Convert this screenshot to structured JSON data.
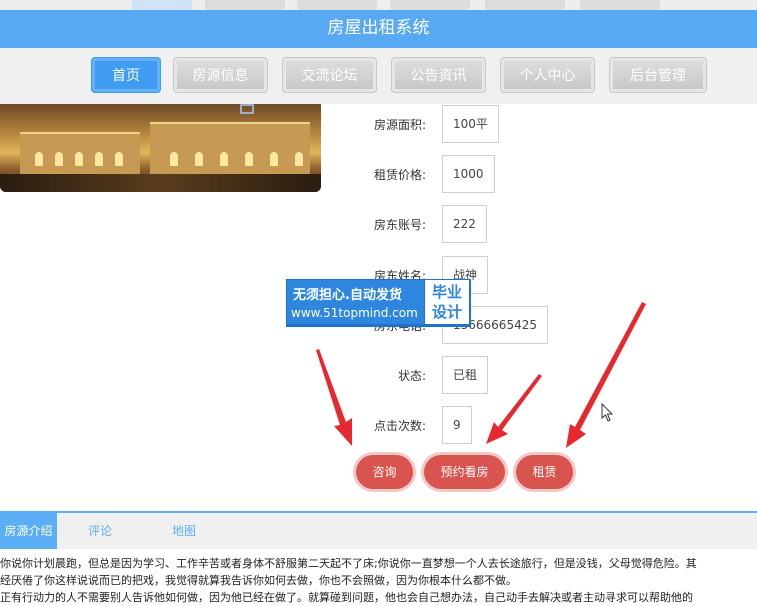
{
  "header": {
    "title": "房屋出租系统"
  },
  "nav": {
    "items": [
      {
        "label": "首页",
        "active": true
      },
      {
        "label": "房源信息",
        "active": false
      },
      {
        "label": "交流论坛",
        "active": false
      },
      {
        "label": "公告资讯",
        "active": false
      },
      {
        "label": "个人中心",
        "active": false
      },
      {
        "label": "后台管理",
        "active": false
      }
    ]
  },
  "details": {
    "fields": [
      {
        "label": "房源面积:",
        "value": "100平"
      },
      {
        "label": "租赁价格:",
        "value": "1000"
      },
      {
        "label": "房东账号:",
        "value": "222"
      },
      {
        "label": "房东姓名:",
        "value": "战神"
      },
      {
        "label": "房东电话:",
        "value": "13666665425"
      },
      {
        "label": "状态:",
        "value": "已租"
      },
      {
        "label": "点击次数:",
        "value": "9"
      }
    ]
  },
  "actions": {
    "consult": "咨询",
    "book_viewing": "预约看房",
    "rent": "租赁"
  },
  "watermark": {
    "line1": "无须担心.自动发货",
    "line2": "www.51topmind.com",
    "side_top": "毕业",
    "side_bottom": "设计"
  },
  "tabs": [
    {
      "label": "房源介绍",
      "active": true
    },
    {
      "label": "评论",
      "active": false
    },
    {
      "label": "地图",
      "active": false
    }
  ],
  "description": {
    "lines": [
      "你说你计划晨跑，但总是因为学习、工作辛苦或者身体不舒服第二天起不了床;你说你一直梦想一个人去长途旅行，但是没钱，父母觉得危险。其",
      "经厌倦了你这样说说而已的把戏，我觉得就算我告诉你如何去做，你也不会照做，因为你根本什么都不做。",
      "正有行动力的人不需要别人告诉他如何做，因为他已经在做了。就算碰到问题，他也会自己想办法，自己动手去解决或者主动寻求可以帮助他的"
    ]
  },
  "colors": {
    "accent": "#56a9f2",
    "action": "#d9534f",
    "arrow": "#e8282f"
  }
}
